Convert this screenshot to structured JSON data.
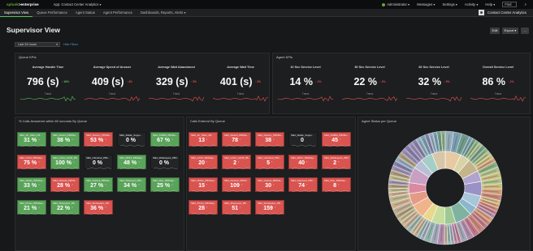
{
  "topbar": {
    "logo_splunk": "splunk",
    "logo_rest": ">enterprise",
    "app_menu": "App: Contact Center Analytics ▾",
    "menus": [
      "Administrator ▾",
      "Messages ▾",
      "Settings ▾",
      "Activity ▾",
      "Help ▾"
    ],
    "find": "Find"
  },
  "nav": {
    "tabs": [
      "Supervisor View",
      "Queue Performance",
      "Agent Status",
      "Agent Performance",
      "Dashboards, Reports, Alerts ▾"
    ],
    "active_index": 0,
    "brand": "Contact Center Analytics"
  },
  "page": {
    "title": "Supervisor View",
    "edit": "Edit",
    "export": "Export ▾",
    "more": "..."
  },
  "filters": {
    "time": "Last 24 hours",
    "hide": "Hide Filters"
  },
  "queue_kpis": {
    "title": "Queue KPIs",
    "items": [
      {
        "title": "Average Handle Time",
        "value": "796 (s)",
        "delta": "↓ 16%",
        "color": "#5cc05c",
        "trend_label": "Trend"
      },
      {
        "title": "Average Speed of Answer",
        "value": "409 (s)",
        "delta": "↑ 4%",
        "color": "#e0524d",
        "trend_label": "Trend"
      },
      {
        "title": "Average Wait Abandoned",
        "value": "329 (s)",
        "delta": "↑ 3%",
        "color": "#e0524d",
        "trend_label": "Trend"
      },
      {
        "title": "Average Wait Time",
        "value": "401 (s)",
        "delta": "↑ 3%",
        "color": "#e0524d",
        "trend_label": "Trend"
      }
    ]
  },
  "agent_kpis": {
    "title": "Agent KPIs",
    "items": [
      {
        "title": "10 Sec Service Level",
        "value": "14 %",
        "delta": "↓ 1%",
        "color": "#e0524d",
        "trend_label": "Trend"
      },
      {
        "title": "30 Sec Service Level",
        "value": "22 %",
        "delta": "↓ 2%",
        "color": "#e0524d",
        "trend_label": "Trend"
      },
      {
        "title": "60 Sec Service Level",
        "value": "32 %",
        "delta": "↓ 3%",
        "color": "#e0524d",
        "trend_label": "Trend"
      },
      {
        "title": "Overall Service Level",
        "value": "86 %",
        "delta": "↓ 1%",
        "color": "#e0524d",
        "trend_label": "Trend"
      }
    ]
  },
  "calls_answered": {
    "title": "% Calls Answered within 60 seconds By Queue",
    "tiles": [
      {
        "name": "SMA_AF_Office_PB...",
        "value": "31 %",
        "status": "g"
      },
      {
        "name": "SMA_Default_PBXMa...",
        "value": "38 %",
        "status": "g"
      },
      {
        "name": "SMA_Delivery_PBXMa...",
        "value": "53 %",
        "status": "r"
      },
      {
        "name": "SMA_Mobile_Suppo...",
        "value": "0 %",
        "status": "k"
      },
      {
        "name": "SMA_IOMBH_PBXMa...",
        "value": "67 %",
        "status": "g"
      },
      {
        "name": "SMA_LUNA_PBXMap...",
        "value": "75 %",
        "status": "r"
      },
      {
        "name": "SMA_LUNA_AACB_PB...",
        "value": "100 %",
        "status": "g"
      },
      {
        "name": "SMA_LiftnotCal_PBX...",
        "value": "0 %",
        "status": "k"
      },
      {
        "name": "SMA_MPLS_PBXMap...",
        "value": "48 %",
        "status": "g"
      },
      {
        "name": "SMA_Mobilespots_PBX...",
        "value": "0 %",
        "status": "k"
      },
      {
        "name": "SMA_Mobile_PBXMap...",
        "value": "33 %",
        "status": "g"
      },
      {
        "name": "SMA_Network_PBXM...",
        "value": "28 %",
        "status": "r"
      },
      {
        "name": "SMA_Outlook_PBXMa...",
        "value": "27 %",
        "status": "g"
      },
      {
        "name": "SMA_Password_PBX...",
        "value": "34 %",
        "status": "g"
      },
      {
        "name": "SMA_Plan_PBXMap...",
        "value": "25 %",
        "status": "g"
      },
      {
        "name": "SMA_Printer_PBXMap...",
        "value": "21 %",
        "status": "g"
      },
      {
        "name": "SMA_Sharepoint_PB...",
        "value": "22 %",
        "status": "g"
      },
      {
        "name": "SMA_Workstation_PB...",
        "value": "36 %",
        "status": "r"
      }
    ]
  },
  "calls_entered": {
    "title": "Calls Entered By Queue",
    "tiles": [
      {
        "name": "SMA_AF_Office_PB...",
        "value": "13",
        "status": "r"
      },
      {
        "name": "SMA_Default_PBXMa...",
        "value": "78",
        "status": "r"
      },
      {
        "name": "SMA_Delivery_PBXMa...",
        "value": "38",
        "status": "r"
      },
      {
        "name": "SMA_Mobile_Suppo...",
        "value": "0",
        "status": "k"
      },
      {
        "name": "SMA_IOMBH_PBXMa...",
        "value": "45",
        "status": "r"
      },
      {
        "name": "SMA_LUNA_PBXMap...",
        "value": "20",
        "status": "r"
      },
      {
        "name": "SMA_LUNA_AACB_PB...",
        "value": "2",
        "status": "r"
      },
      {
        "name": "SMA_LiftnotCal_PBX...",
        "value": "5",
        "status": "r"
      },
      {
        "name": "SMA_MPLS_PBXMap...",
        "value": "40",
        "status": "r"
      },
      {
        "name": "SMA_Mobilespots_PBX...",
        "value": "2",
        "status": "r"
      },
      {
        "name": "SMA_Mobile_PBXMap...",
        "value": "15",
        "status": "r"
      },
      {
        "name": "SMA_Network_PBXM...",
        "value": "109",
        "status": "r"
      },
      {
        "name": "SMA_Outlook_PBXMa...",
        "value": "30",
        "status": "r"
      },
      {
        "name": "SMA_Password_PBX...",
        "value": "74",
        "status": "r"
      },
      {
        "name": "SMA_Plan_PBXMap...",
        "value": "8",
        "status": "r"
      },
      {
        "name": "SMA_Printer_PBXMap...",
        "value": "28",
        "status": "r"
      },
      {
        "name": "SMA_Sharepoint_PB...",
        "value": "51",
        "status": "r"
      },
      {
        "name": "SMA_Workstation_PB...",
        "value": "159",
        "status": "r"
      }
    ]
  },
  "agent_status": {
    "title": "Agent Status per Queue",
    "colors": [
      "#e7c9a4",
      "#d9d2a5",
      "#c4b48a",
      "#b0a4cf",
      "#9a92c6",
      "#a7c6d9",
      "#8ab7cc",
      "#7fb3a0",
      "#9ec894",
      "#c7dd9c",
      "#e9d78e",
      "#f0b48a",
      "#e59a88",
      "#d98aa0",
      "#c99fc4",
      "#b8c0d6",
      "#a3cfc8",
      "#d8c6a8"
    ]
  }
}
